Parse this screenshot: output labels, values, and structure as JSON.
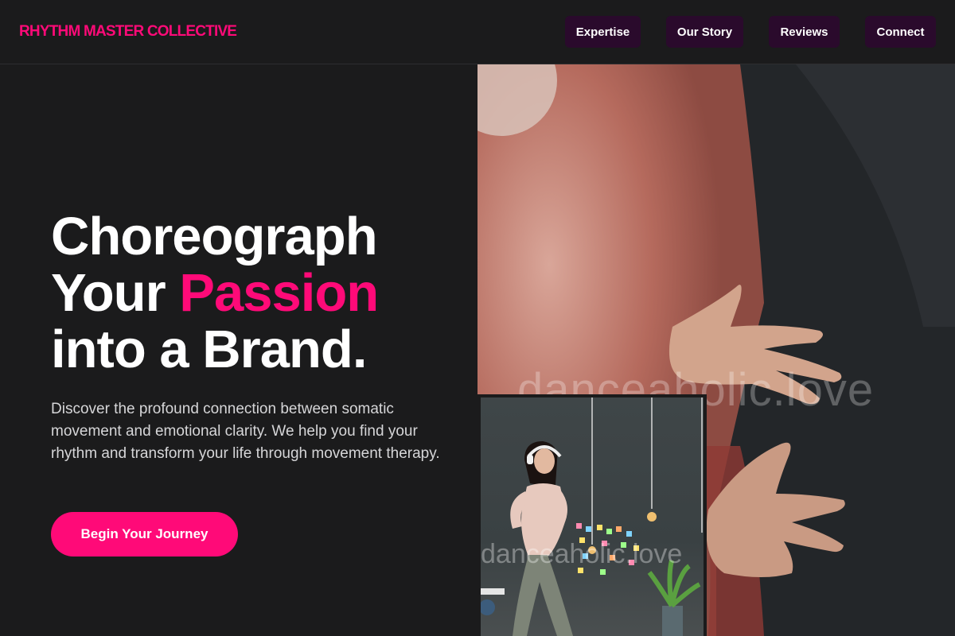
{
  "header": {
    "brand": "RHYTHM MASTER COLLECTIVE",
    "nav": [
      {
        "label": "Expertise"
      },
      {
        "label": "Our Story"
      },
      {
        "label": "Reviews"
      },
      {
        "label": "Connect"
      }
    ]
  },
  "hero": {
    "title_line1": "Choreograph",
    "title_line2_prefix": "Your ",
    "title_line2_accent": "Passion",
    "title_line3": "into a Brand.",
    "description": "Discover the profound connection between somatic movement and emotional clarity. We help you find your rhythm and transform your life through movement therapy.",
    "cta_label": "Begin Your Journey"
  },
  "images": {
    "main_watermark": "danceaholic.love",
    "inset_watermark": "danceaholic.love",
    "main_alt_icon": "hands-dance-photo",
    "inset_alt_icon": "woman-dancing-headphones-photo"
  },
  "colors": {
    "accent": "#ff0a78",
    "background": "#1b1b1c",
    "nav_button": "#2a0a2c"
  }
}
